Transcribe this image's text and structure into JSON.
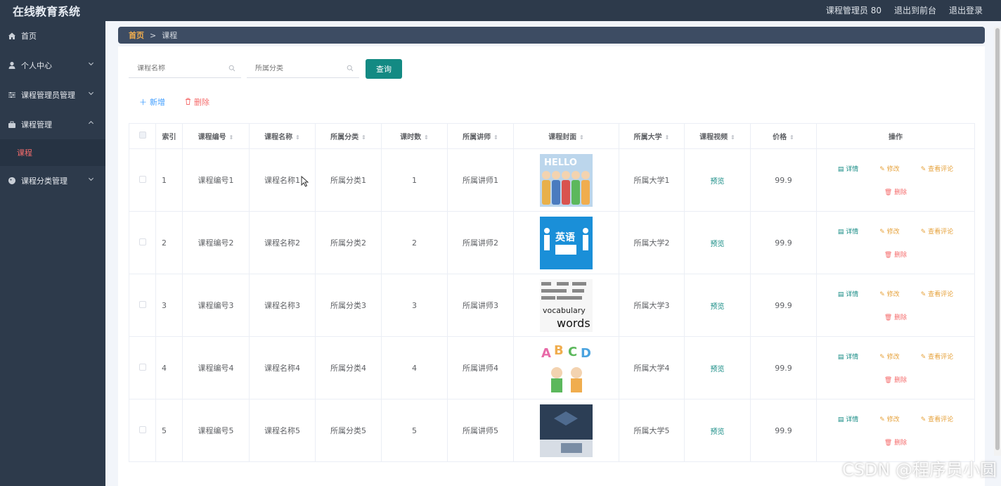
{
  "app": {
    "title": "在线教育系统"
  },
  "topbar": {
    "user": "课程管理员 80",
    "to_front": "退出到前台",
    "logout": "退出登录"
  },
  "sidebar": {
    "items": [
      {
        "label": "首页",
        "icon": "home-icon"
      },
      {
        "label": "个人中心",
        "icon": "user-icon"
      },
      {
        "label": "课程管理员管理",
        "icon": "sliders-icon"
      },
      {
        "label": "课程管理",
        "icon": "briefcase-icon"
      },
      {
        "label": "课程分类管理",
        "icon": "tag-icon"
      }
    ],
    "active_sub": "课程"
  },
  "breadcrumb": {
    "home": "首页",
    "sep": ">",
    "current": "课程"
  },
  "search": {
    "course_name_placeholder": "课程名称",
    "category_placeholder": "所属分类",
    "query_label": "查询"
  },
  "toolbar": {
    "add_label": "新增",
    "delete_label": "删除"
  },
  "table": {
    "headers": [
      "索引",
      "课程编号",
      "课程名称",
      "所属分类",
      "课时数",
      "所属讲师",
      "课程封面",
      "所属大学",
      "课程视频",
      "价格",
      "操作"
    ],
    "preview_label": "预览",
    "op_labels": {
      "detail": "详情",
      "edit": "修改",
      "review": "查看评论",
      "delete": "删除"
    },
    "rows": [
      {
        "index": "1",
        "code": "课程编号1",
        "name": "课程名称1",
        "category": "所属分类1",
        "hours": "1",
        "teacher": "所属讲师1",
        "university": "所属大学1",
        "price": "99.9",
        "cover": "HELLO"
      },
      {
        "index": "2",
        "code": "课程编号2",
        "name": "课程名称2",
        "category": "所属分类2",
        "hours": "2",
        "teacher": "所属讲师2",
        "university": "所属大学2",
        "price": "99.9",
        "cover": "英语"
      },
      {
        "index": "3",
        "code": "课程编号3",
        "name": "课程名称3",
        "category": "所属分类3",
        "hours": "3",
        "teacher": "所属讲师3",
        "university": "所属大学3",
        "price": "99.9",
        "cover": "vocabulary words"
      },
      {
        "index": "4",
        "code": "课程编号4",
        "name": "课程名称4",
        "category": "所属分类4",
        "hours": "4",
        "teacher": "所属讲师4",
        "university": "所属大学4",
        "price": "99.9",
        "cover": "ABCD"
      },
      {
        "index": "5",
        "code": "课程编号5",
        "name": "课程名称5",
        "category": "所属分类5",
        "hours": "5",
        "teacher": "所属讲师5",
        "university": "所属大学5",
        "price": "99.9",
        "cover": ""
      }
    ]
  },
  "watermark": "CSDN @程序员小圆",
  "colors": {
    "sidebar_bg": "#2d3a4b",
    "accent": "#138a83",
    "danger": "#f56c6c",
    "warning": "#e6a23c"
  }
}
